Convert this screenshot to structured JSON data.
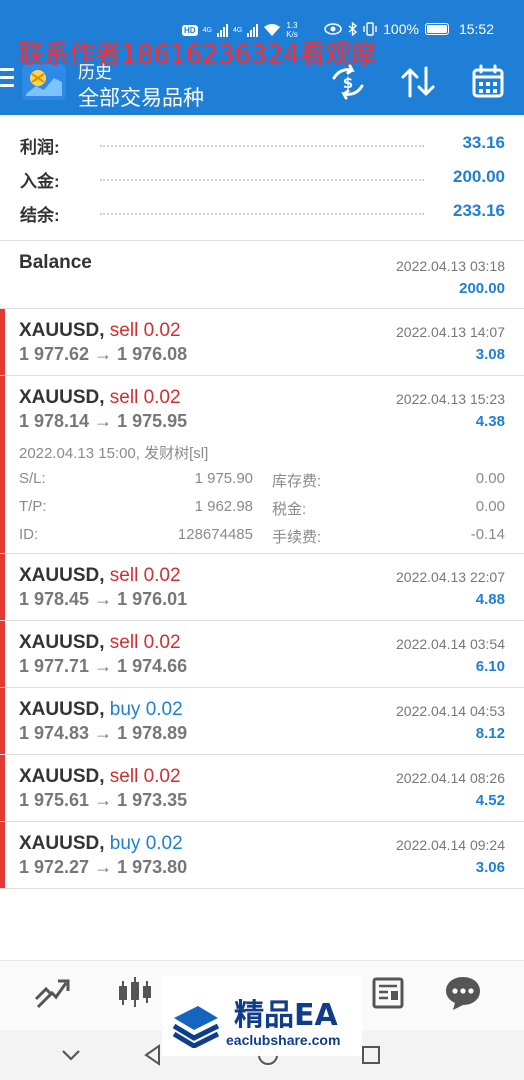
{
  "statusbar": {
    "hd_chip": "HD",
    "net_a": "4G",
    "net_b": "4G",
    "speed_value": "1.3",
    "speed_unit": "K/s",
    "battery": "100%",
    "time": "15:52"
  },
  "watermark_text": "联系作者18616236324看观摩",
  "header": {
    "subtitle": "历史",
    "title": "全部交易品种"
  },
  "summary": [
    {
      "label": "利润:",
      "value": "33.16"
    },
    {
      "label": "入金:",
      "value": "200.00"
    },
    {
      "label": "结余:",
      "value": "233.16"
    }
  ],
  "balance": {
    "label": "Balance",
    "time": "2022.04.13 03:18",
    "amount": "200.00"
  },
  "deals": [
    {
      "symbol": "XAUUSD,",
      "side": "sell 0.02",
      "side_type": "sell",
      "prices": "1 977.62 → 1 976.08",
      "time": "2022.04.13 14:07",
      "profit": "3.08"
    },
    {
      "symbol": "XAUUSD,",
      "side": "sell 0.02",
      "side_type": "sell",
      "prices": "1 978.14 → 1 975.95",
      "time": "2022.04.13 15:23",
      "profit": "4.38"
    },
    {
      "symbol": "XAUUSD,",
      "side": "sell 0.02",
      "side_type": "sell",
      "prices": "1 978.45 → 1 976.01",
      "time": "2022.04.13 22:07",
      "profit": "4.88"
    },
    {
      "symbol": "XAUUSD,",
      "side": "sell 0.02",
      "side_type": "sell",
      "prices": "1 977.71 → 1 974.66",
      "time": "2022.04.14 03:54",
      "profit": "6.10"
    },
    {
      "symbol": "XAUUSD,",
      "side": "buy 0.02",
      "side_type": "buy",
      "prices": "1 974.83 → 1 978.89",
      "time": "2022.04.14 04:53",
      "profit": "8.12"
    },
    {
      "symbol": "XAUUSD,",
      "side": "sell 0.02",
      "side_type": "sell",
      "prices": "1 975.61 → 1 973.35",
      "time": "2022.04.14 08:26",
      "profit": "4.52"
    },
    {
      "symbol": "XAUUSD,",
      "side": "buy 0.02",
      "side_type": "buy",
      "prices": "1 972.27 → 1 973.80",
      "time": "2022.04.14 09:24",
      "profit": "3.06"
    }
  ],
  "expanded": {
    "comment": "2022.04.13 15:00, 发财树[sl]",
    "sl_label": "S/L:",
    "sl_value": "1 975.90",
    "tp_label": "T/P:",
    "tp_value": "1 962.98",
    "id_label": "ID:",
    "id_value": "128674485",
    "swap_label": "库存费:",
    "swap_value": "0.00",
    "tax_label": "税金:",
    "tax_value": "0.00",
    "fee_label": "手续费:",
    "fee_value": "-0.14"
  },
  "ea_watermark": {
    "title": "精品EA",
    "url": "eaclubshare.com"
  },
  "colors": {
    "brand": "#1f7fd6",
    "sell": "#d32f2f",
    "accent": "#e53935"
  },
  "icons": {
    "header": [
      "currency-exchange-icon",
      "sort-icon",
      "calendar-icon"
    ],
    "tabs": [
      "trade-icon",
      "candlestick-chart-icon",
      "news-icon",
      "chat-icon"
    ],
    "nav": [
      "chevron-down-icon",
      "back-icon",
      "home-icon",
      "recents-icon"
    ]
  }
}
